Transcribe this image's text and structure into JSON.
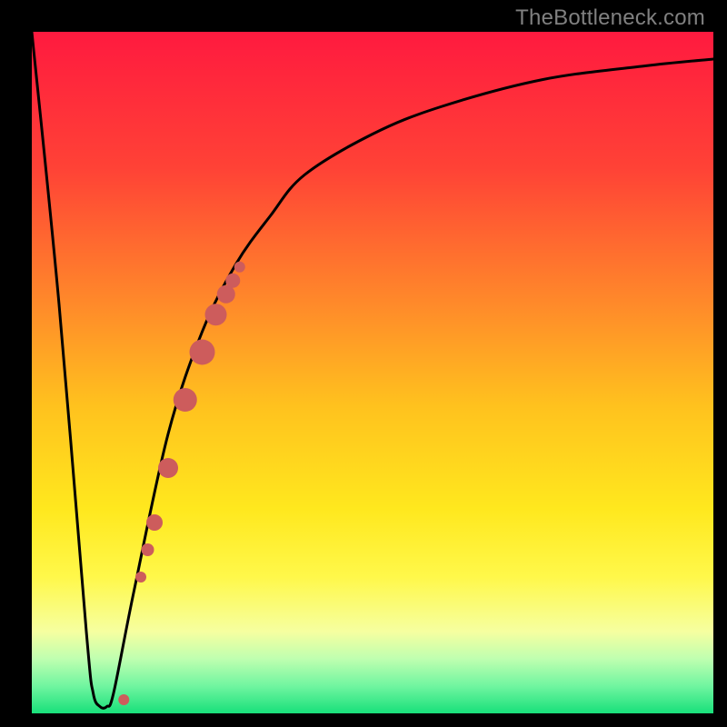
{
  "watermark": "TheBottleneck.com",
  "chart_data": {
    "type": "line",
    "title": "",
    "xlabel": "",
    "ylabel": "",
    "xlim": [
      0,
      100
    ],
    "ylim": [
      0,
      100
    ],
    "background_gradient_stops": [
      {
        "offset": 0.0,
        "color": "#ff1a3f"
      },
      {
        "offset": 0.2,
        "color": "#ff4236"
      },
      {
        "offset": 0.4,
        "color": "#ff8a2a"
      },
      {
        "offset": 0.55,
        "color": "#ffc21e"
      },
      {
        "offset": 0.7,
        "color": "#ffe81e"
      },
      {
        "offset": 0.8,
        "color": "#fff84a"
      },
      {
        "offset": 0.88,
        "color": "#f6ffa0"
      },
      {
        "offset": 0.92,
        "color": "#bfffb0"
      },
      {
        "offset": 0.96,
        "color": "#70f5a0"
      },
      {
        "offset": 1.0,
        "color": "#18e07a"
      }
    ],
    "series": [
      {
        "name": "bottleneck-curve",
        "color": "#000000",
        "x": [
          0,
          4,
          8,
          9,
          10,
          11,
          12,
          15,
          20,
          25,
          30,
          35,
          40,
          50,
          60,
          75,
          90,
          100
        ],
        "y": [
          100,
          60,
          12,
          3,
          1,
          1,
          3,
          18,
          41,
          56,
          66,
          73,
          79,
          85,
          89,
          93,
          95,
          96
        ]
      }
    ],
    "markers": {
      "name": "bottleneck-markers",
      "color": "#cd5c5c",
      "x": [
        13.5,
        16.0,
        17.0,
        18.0,
        20.0,
        22.5,
        25.0,
        27.0,
        28.5,
        29.5,
        30.5
      ],
      "y": [
        2.0,
        20.0,
        24.0,
        28.0,
        36.0,
        46.0,
        53.0,
        58.5,
        61.5,
        63.5,
        65.5
      ],
      "r": [
        6,
        6,
        7,
        9,
        11,
        13,
        14,
        12,
        10,
        8,
        6
      ]
    }
  }
}
